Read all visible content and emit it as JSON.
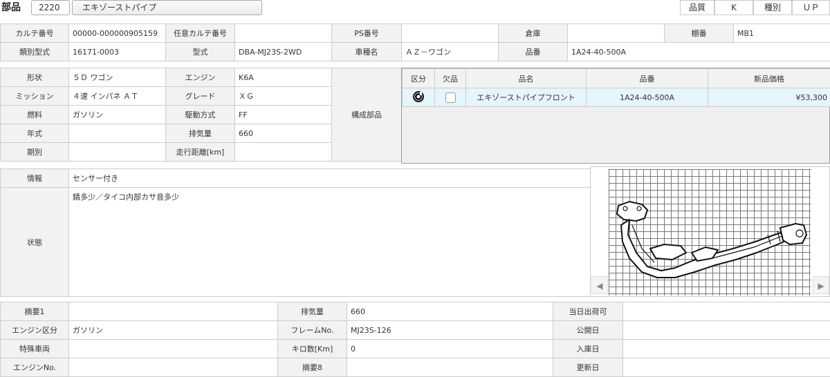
{
  "header": {
    "title": "部品",
    "code": "2220",
    "part_name": "エキゾーストパイプ",
    "quality_label": "品質",
    "quality_value": "K",
    "kind_label": "種別",
    "kind_value": "ＵＰ"
  },
  "row1": {
    "karte_label": "カルテ番号",
    "karte_value": "00000-000000905159",
    "nini_label": "任意カルテ番号",
    "nini_value": "",
    "ps_label": "PS番号",
    "ps_value": "",
    "souko_label": "倉庫",
    "souko_value": "",
    "tana_label": "棚番",
    "tana_value": "MB1"
  },
  "row2": {
    "ruibetsu_label": "類別型式",
    "ruibetsu_value": "16171-0003",
    "katashiki_label": "型式",
    "katashiki_value": "DBA-MJ23S-2WD",
    "shamei_label": "車種名",
    "shamei_value": "ＡＺ－ワゴン",
    "hinban_label": "品番",
    "hinban_value": "1A24-40-500A"
  },
  "spec": {
    "keijo_label": "形状",
    "keijo_value": "５Ｄ ワゴン",
    "engine_label": "エンジン",
    "engine_value": "K6A",
    "mission_label": "ミッション",
    "mission_value": "４速 インパネ ＡＴ",
    "grade_label": "グレード",
    "grade_value": "ＸＧ",
    "nenryo_label": "燃料",
    "nenryo_value": "ガソリン",
    "kudou_label": "駆動方式",
    "kudou_value": "FF",
    "nenshiki_label": "年式",
    "nenshiki_value": "",
    "haiki_label": "排気量",
    "haiki_value": "660",
    "kibetsu_label": "期別",
    "kibetsu_value": "",
    "soukou_label": "走行距離[km]",
    "soukou_value": "",
    "kousei_label": "構成部品"
  },
  "parts_table": {
    "headers": [
      "区分",
      "欠品",
      "品名",
      "品番",
      "新品価格"
    ],
    "rows": [
      {
        "icon": "disc-icon",
        "name": "エキゾーストパイプフロント",
        "number": "1A24-40-500A",
        "price": "¥53,300"
      }
    ]
  },
  "info": {
    "joho_label": "情報",
    "joho_value": "センサー付き",
    "joutai_label": "状態",
    "joutai_value": "錆多少／タイコ内部カサ音多少"
  },
  "bottom": {
    "tekiyo1_label": "摘要1",
    "tekiyo1_value": "",
    "haiki_label": "排気量",
    "haiki_value": "660",
    "touzitsu_label": "当日出荷可",
    "touzitsu_value": "",
    "engine_kubun_label": "エンジン区分",
    "engine_kubun_value": "ガソリン",
    "frame_label": "フレームNo.",
    "frame_value": "MJ23S-126",
    "koukai_label": "公開日",
    "koukai_value": "",
    "tokushu_label": "特殊車両",
    "tokushu_value": "",
    "kiro_label": "キロ数[Km]",
    "kiro_value": "0",
    "nyuuko_label": "入庫日",
    "nyuuko_value": "",
    "engine_no_label": "エンジンNo.",
    "engine_no_value": "",
    "tekiyo8_label": "摘要8",
    "tekiyo8_value": "",
    "koushin_label": "更新日",
    "koushin_value": ""
  },
  "image_nav": {
    "left": "◀",
    "right": "▶"
  }
}
